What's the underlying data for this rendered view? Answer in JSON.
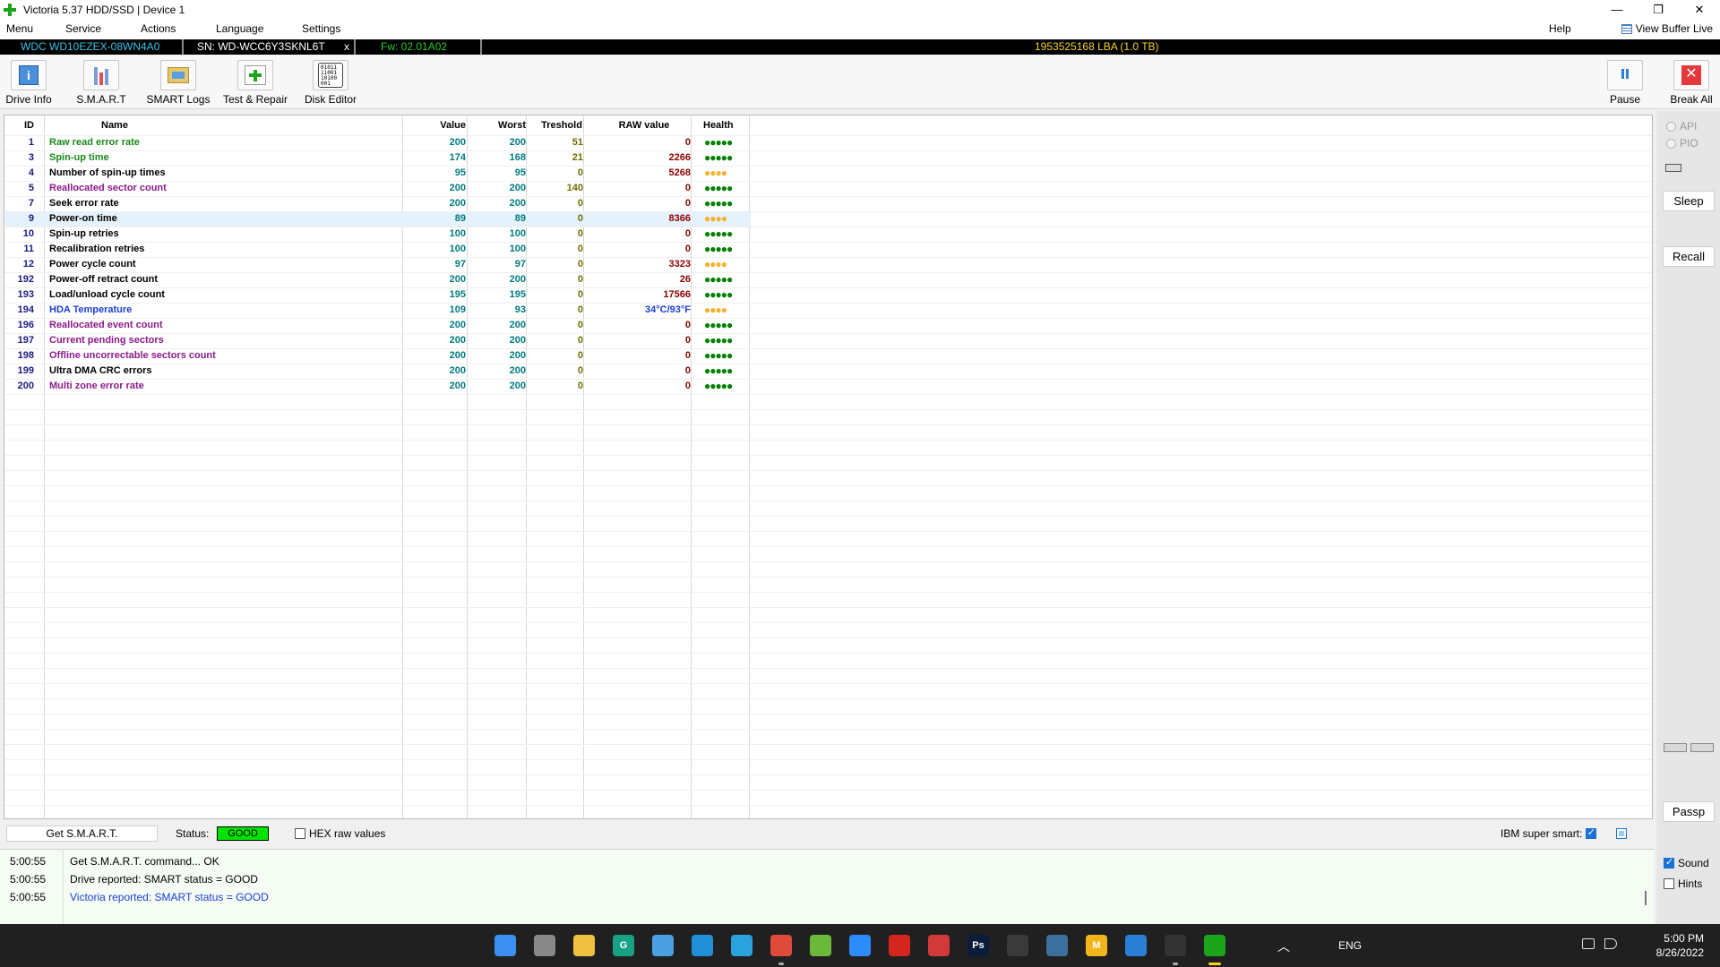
{
  "window": {
    "title": "Victoria 5.37 HDD/SSD | Device 1",
    "controls": {
      "minimize": "—",
      "maximize": "❐",
      "close": "✕"
    }
  },
  "menu": {
    "items": [
      "Menu",
      "Service",
      "Actions",
      "Language",
      "Settings"
    ],
    "help": "Help",
    "view_buffer": "View Buffer Live"
  },
  "device": {
    "model": "WDC WD10EZEX-08WN4A0",
    "serial": "SN: WD-WCC6Y3SKNL6T",
    "close": "x",
    "firmware": "Fw: 02.01A02",
    "lba": "1953525168 LBA (1.0 TB)"
  },
  "toolbar": {
    "drive_info": "Drive Info",
    "smart": "S.M.A.R.T",
    "smart_logs": "SMART Logs",
    "test_repair": "Test & Repair",
    "disk_editor": "Disk Editor",
    "pause": "Pause",
    "break_all": "Break All",
    "drive_info_glyph": "i",
    "break_glyph": "✕",
    "disk_editor_glyph": "01011 11001 10100 001"
  },
  "table": {
    "headers": [
      "ID",
      "Name",
      "Value",
      "Worst",
      "Treshold",
      "RAW value",
      "Health"
    ],
    "rows": [
      {
        "id": "1",
        "name": "Raw read error rate",
        "value": "200",
        "worst": "200",
        "threshold": "51",
        "raw": "0",
        "health": "●●●●●",
        "name_color": "#1a8a1a",
        "health_level": "good"
      },
      {
        "id": "3",
        "name": "Spin-up time",
        "value": "174",
        "worst": "168",
        "threshold": "21",
        "raw": "2266",
        "health": "●●●●●",
        "name_color": "#1a8a1a",
        "health_level": "good"
      },
      {
        "id": "4",
        "name": "Number of spin-up times",
        "value": "95",
        "worst": "95",
        "threshold": "0",
        "raw": "5268",
        "health": "●●●●",
        "name_color": "#000000",
        "health_level": "warn"
      },
      {
        "id": "5",
        "name": "Reallocated sector count",
        "value": "200",
        "worst": "200",
        "threshold": "140",
        "raw": "0",
        "health": "●●●●●",
        "name_color": "#8b1a8b",
        "health_level": "good"
      },
      {
        "id": "7",
        "name": "Seek error rate",
        "value": "200",
        "worst": "200",
        "threshold": "0",
        "raw": "0",
        "health": "●●●●●",
        "name_color": "#000000",
        "health_level": "good"
      },
      {
        "id": "9",
        "name": "Power-on time",
        "value": "89",
        "worst": "89",
        "threshold": "0",
        "raw": "8366",
        "health": "●●●●",
        "name_color": "#000000",
        "health_level": "warn"
      },
      {
        "id": "10",
        "name": "Spin-up retries",
        "value": "100",
        "worst": "100",
        "threshold": "0",
        "raw": "0",
        "health": "●●●●●",
        "name_color": "#000000",
        "health_level": "good"
      },
      {
        "id": "11",
        "name": "Recalibration retries",
        "value": "100",
        "worst": "100",
        "threshold": "0",
        "raw": "0",
        "health": "●●●●●",
        "name_color": "#000000",
        "health_level": "good"
      },
      {
        "id": "12",
        "name": "Power cycle count",
        "value": "97",
        "worst": "97",
        "threshold": "0",
        "raw": "3323",
        "health": "●●●●",
        "name_color": "#000000",
        "health_level": "warn"
      },
      {
        "id": "192",
        "name": "Power-off retract count",
        "value": "200",
        "worst": "200",
        "threshold": "0",
        "raw": "26",
        "health": "●●●●●",
        "name_color": "#000000",
        "health_level": "good"
      },
      {
        "id": "193",
        "name": "Load/unload cycle count",
        "value": "195",
        "worst": "195",
        "threshold": "0",
        "raw": "17566",
        "health": "●●●●●",
        "name_color": "#000000",
        "health_level": "good"
      },
      {
        "id": "194",
        "name": "HDA Temperature",
        "value": "109",
        "worst": "93",
        "threshold": "0",
        "raw": "34°C/93°F",
        "health": "●●●●",
        "name_color": "#1a3fd9",
        "health_level": "warn"
      },
      {
        "id": "196",
        "name": "Reallocated event count",
        "value": "200",
        "worst": "200",
        "threshold": "0",
        "raw": "0",
        "health": "●●●●●",
        "name_color": "#8b1a8b",
        "health_level": "good"
      },
      {
        "id": "197",
        "name": "Current pending sectors",
        "value": "200",
        "worst": "200",
        "threshold": "0",
        "raw": "0",
        "health": "●●●●●",
        "name_color": "#8b1a8b",
        "health_level": "good"
      },
      {
        "id": "198",
        "name": "Offline uncorrectable sectors count",
        "value": "200",
        "worst": "200",
        "threshold": "0",
        "raw": "0",
        "health": "●●●●●",
        "name_color": "#8b1a8b",
        "health_level": "good"
      },
      {
        "id": "199",
        "name": "Ultra DMA CRC errors",
        "value": "200",
        "worst": "200",
        "threshold": "0",
        "raw": "0",
        "health": "●●●●●",
        "name_color": "#000000",
        "health_level": "good"
      },
      {
        "id": "200",
        "name": "Multi zone error rate",
        "value": "200",
        "worst": "200",
        "threshold": "0",
        "raw": "0",
        "health": "●●●●●",
        "name_color": "#8b1a8b",
        "health_level": "good"
      }
    ],
    "selected_id": "9"
  },
  "right_panel": {
    "api": "API",
    "pio": "PIO",
    "sleep": "Sleep",
    "recall": "Recall",
    "passp": "Passp"
  },
  "status_row": {
    "get_smart": "Get S.M.A.R.T.",
    "status_label": "Status:",
    "status_value": "GOOD",
    "hex_raw": "HEX raw values",
    "ibm_super_smart": "IBM super smart:"
  },
  "log": [
    {
      "time": "5:00:55",
      "message": "Get S.M.A.R.T. command... OK",
      "style": "normal"
    },
    {
      "time": "5:00:55",
      "message": "Drive reported: SMART status = GOOD",
      "style": "normal"
    },
    {
      "time": "5:00:55",
      "message": "Victoria reported: SMART status = GOOD",
      "style": "blue"
    }
  ],
  "options": {
    "sound": "Sound",
    "hints": "Hints"
  },
  "taskbar": {
    "lang": "ENG",
    "time": "5:00 PM",
    "date": "8/26/2022",
    "tray_chevron": "︿",
    "apps": [
      {
        "name": "start",
        "glyph": "",
        "color": "#3a8ff0"
      },
      {
        "name": "task-view",
        "glyph": "",
        "color": "#888888"
      },
      {
        "name": "file-explorer",
        "glyph": "",
        "color": "#f0c040"
      },
      {
        "name": "grammarly",
        "glyph": "G",
        "color": "#15a383"
      },
      {
        "name": "photos",
        "glyph": "",
        "color": "#4aa0e0"
      },
      {
        "name": "edge",
        "glyph": "",
        "color": "#1f8fd8"
      },
      {
        "name": "telegram",
        "glyph": "",
        "color": "#2aa2de"
      },
      {
        "name": "chrome",
        "glyph": "",
        "color": "#e04a3a"
      },
      {
        "name": "utorrent",
        "glyph": "",
        "color": "#6bb83b"
      },
      {
        "name": "zoom",
        "glyph": "",
        "color": "#2d8cff"
      },
      {
        "name": "acrobat",
        "glyph": "",
        "color": "#d4261c"
      },
      {
        "name": "calculator-app",
        "glyph": "",
        "color": "#d23a3a"
      },
      {
        "name": "photoshop",
        "glyph": "Ps",
        "color": "#0a1d3a"
      },
      {
        "name": "davinci",
        "glyph": "",
        "color": "#3a3a3a"
      },
      {
        "name": "vm-app",
        "glyph": "",
        "color": "#3d6f9c"
      },
      {
        "name": "m-app",
        "glyph": "M",
        "color": "#f2b51c"
      },
      {
        "name": "sync-app",
        "glyph": "",
        "color": "#2a7fd4"
      },
      {
        "name": "terminal",
        "glyph": "",
        "color": "#333333"
      },
      {
        "name": "victoria",
        "glyph": "",
        "color": "#1aa51a"
      }
    ]
  }
}
